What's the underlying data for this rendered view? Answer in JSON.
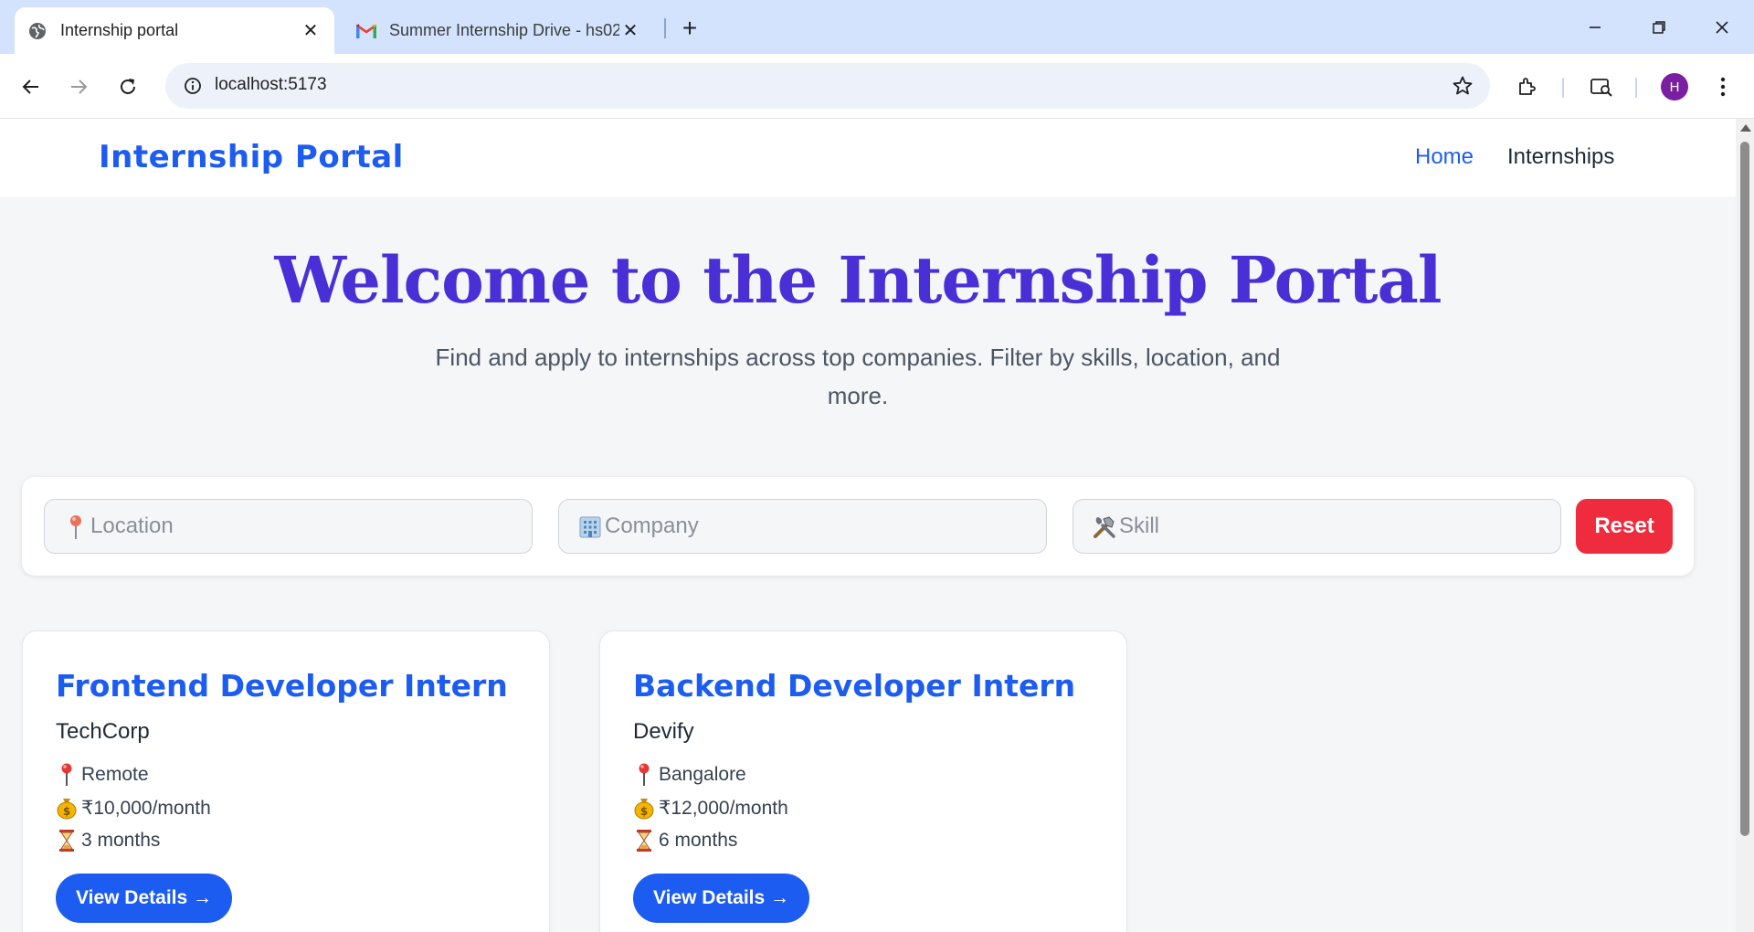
{
  "browser": {
    "tabs": [
      {
        "title": "Internship portal",
        "active": true,
        "favicon": "globe-icon"
      },
      {
        "title": "Summer Internship Drive - hs02",
        "active": false,
        "favicon": "gmail-icon"
      }
    ],
    "url": "localhost:5173",
    "profile_initial": "H"
  },
  "site": {
    "brand": "Internship Portal",
    "nav": [
      {
        "label": "Home",
        "active": true
      },
      {
        "label": "Internships",
        "active": false
      }
    ]
  },
  "hero": {
    "title": "Welcome to the Internship Portal",
    "subtitle": "Find and apply to internships across top companies. Filter by skills, location, and more."
  },
  "filters": {
    "location": {
      "placeholder": "Location",
      "icon": "pin-icon",
      "value": ""
    },
    "company": {
      "placeholder": "Company",
      "icon": "building-icon",
      "value": ""
    },
    "skill": {
      "placeholder": "Skill",
      "icon": "tools-icon",
      "value": ""
    },
    "reset_label": "Reset"
  },
  "internships": [
    {
      "title": "Frontend Developer Intern",
      "company": "TechCorp",
      "location": "Remote",
      "stipend": "₹10,000/month",
      "duration": "3 months",
      "button": "View Details →"
    },
    {
      "title": "Backend Developer Intern",
      "company": "Devify",
      "location": "Bangalore",
      "stipend": "₹12,000/month",
      "duration": "6 months",
      "button": "View Details →"
    }
  ],
  "colors": {
    "brand": "#1d5cf0",
    "hero": "#4a2fd6",
    "reset": "#ef2b3e"
  }
}
